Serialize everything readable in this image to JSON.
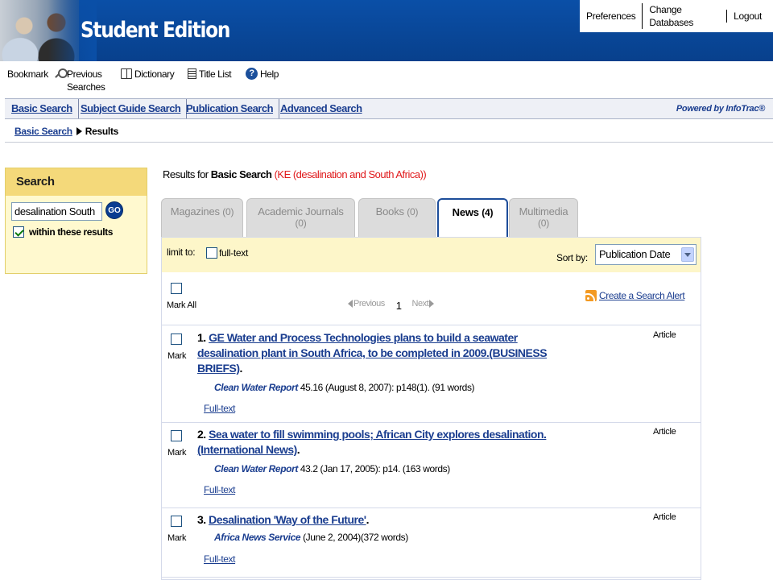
{
  "banner": {
    "brand": "Student Edition",
    "top_links": [
      "Preferences",
      "Change Databases",
      "Logout"
    ]
  },
  "toolbar": {
    "bookmark": "Bookmark",
    "previous_searches_line1": "Previous",
    "previous_searches_line2": "Searches",
    "dictionary": "Dictionary",
    "title_list": "Title List",
    "help": "Help",
    "help_glyph": "?"
  },
  "search_nav": {
    "items": [
      "Basic Search",
      "Subject Guide Search",
      "Publication Search",
      "Advanced Search"
    ],
    "powered_by": "Powered by InfoTrac®"
  },
  "breadcrumb": {
    "link": "Basic Search",
    "current": "Results"
  },
  "side_search": {
    "heading": "Search",
    "input_value": "desalination South",
    "go_label": "GO",
    "within_label": "within these results",
    "within_checked": true
  },
  "results_heading": {
    "prefix": "Results for",
    "search_type": "Basic Search",
    "query": "(KE (desalination and South Africa))",
    "query_color": "#e0191b"
  },
  "tabs": [
    {
      "label": "Magazines",
      "count": "(0)",
      "active": false
    },
    {
      "label": "Academic Journals",
      "count": "(0)",
      "active": false
    },
    {
      "label": "Books",
      "count": "(0)",
      "active": false
    },
    {
      "label": "News",
      "count": "(4)",
      "active": true
    },
    {
      "label": "Multimedia",
      "count": "(0)",
      "active": false
    }
  ],
  "limit_bar": {
    "limit_to": "limit to:",
    "full_text": "full-text",
    "sort_by": "Sort by:",
    "sort_value": "Publication Date"
  },
  "list_controls": {
    "mark_all": "Mark All",
    "previous": "Previous",
    "page": "1",
    "next": "Next",
    "alert": "Create a Search Alert"
  },
  "results": [
    {
      "number": "1.",
      "title": "GE Water and Process Technologies plans to build a seawater desalination plant in South Africa, to be completed in 2009.(BUSINESS BRIEFS)",
      "end_punct": ".",
      "type": "Article",
      "source": "Clean Water Report",
      "citation": " 45.16 (August 8, 2007): p148(1). (91 words)",
      "fulltext": "Full-text",
      "mark": "Mark"
    },
    {
      "number": "2.",
      "title": "Sea water to fill swimming pools; African City explores desalination.(International News)",
      "end_punct": ".",
      "type": "Article",
      "source": "Clean Water Report",
      "citation": " 43.2 (Jan 17, 2005): p14. (163 words)",
      "fulltext": "Full-text",
      "mark": "Mark"
    },
    {
      "number": "3.",
      "title": "Desalination 'Way of the Future'",
      "end_punct": ".",
      "type": "Article",
      "source": "Africa News Service",
      "citation": " (June 2, 2004)(372 words)",
      "fulltext": "Full-text",
      "mark": "Mark"
    }
  ]
}
